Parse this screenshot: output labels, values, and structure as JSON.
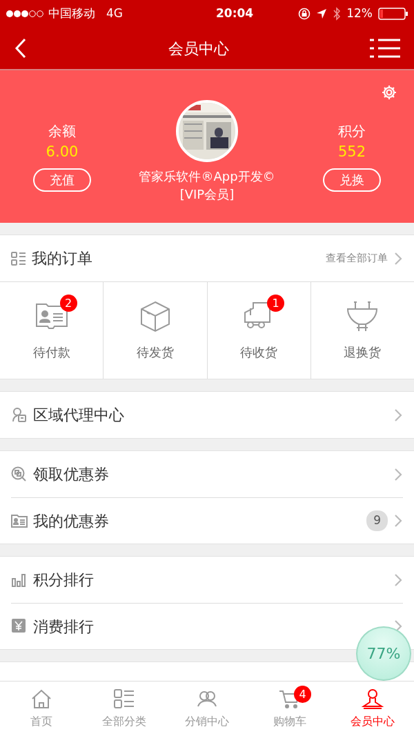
{
  "status_bar": {
    "carrier": "中国移动",
    "network": "4G",
    "time": "20:04",
    "battery": "12%"
  },
  "nav": {
    "title": "会员中心"
  },
  "profile": {
    "balance_label": "余额",
    "balance": "6.00",
    "recharge_button": "充值",
    "name": "管家乐软件®App开发©",
    "member_level": "[VIP会员]",
    "points_label": "积分",
    "points": "552",
    "exchange_button": "兑换"
  },
  "orders": {
    "title": "我的订单",
    "view_all": "查看全部订单",
    "statuses": [
      {
        "label": "待付款",
        "badge": "2"
      },
      {
        "label": "待发货"
      },
      {
        "label": "待收货",
        "badge": "1"
      },
      {
        "label": "退换货"
      }
    ]
  },
  "menu_groups": [
    [
      {
        "label": "区域代理中心"
      }
    ],
    [
      {
        "label": "领取优惠券"
      },
      {
        "label": "我的优惠券",
        "count": "9"
      }
    ],
    [
      {
        "label": "积分排行"
      },
      {
        "label": "消费排行"
      }
    ]
  ],
  "tab_bar": [
    {
      "label": "首页",
      "selected": false
    },
    {
      "label": "全部分类",
      "selected": false
    },
    {
      "label": "分销中心",
      "selected": false
    },
    {
      "label": "购物车",
      "selected": false,
      "badge": "4"
    },
    {
      "label": "会员中心",
      "selected": true
    }
  ],
  "floating_ball": {
    "reading": "77%"
  }
}
